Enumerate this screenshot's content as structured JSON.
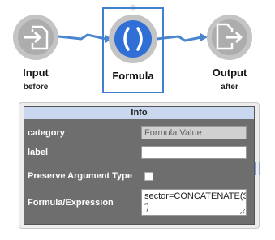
{
  "nodes": {
    "input": {
      "label": "Input",
      "sublabel": "before",
      "icon": "import-arrow-icon"
    },
    "formula": {
      "label": "Formula",
      "icon": "parentheses-icon",
      "selected": true
    },
    "output": {
      "label": "Output",
      "sublabel": "after",
      "icon": "export-arrow-icon"
    }
  },
  "colors": {
    "accent": "#3f80d0",
    "node_gray": "#b5b5b5",
    "connector": "#4a86cf",
    "info_header": "#c9d8ef",
    "panel_bg": "#6e6e6e"
  },
  "info": {
    "title": "Info",
    "rows": [
      {
        "label": "category",
        "value": "Formula Value",
        "readonly": true
      },
      {
        "label": "label",
        "value": ""
      },
      {
        "label": "Preserve Argument Type",
        "checked": false
      },
      {
        "label": "Formula/Expression",
        "value": "sector=CONCATENATE(Sector,', ')"
      }
    ]
  }
}
